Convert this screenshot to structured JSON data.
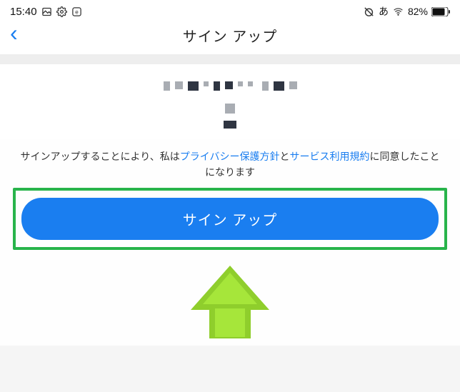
{
  "statusbar": {
    "time": "15:40",
    "lang_indicator": "あ",
    "battery_pct": "82%"
  },
  "header": {
    "title": "サイン アップ"
  },
  "consent": {
    "prefix": "サインアップすることにより、私は",
    "privacy_link": "プライバシー保護方針",
    "and": "と",
    "terms_link": "サービス利用規約",
    "suffix": "に同意したことになります"
  },
  "button": {
    "signup_label": "サイン アップ"
  }
}
